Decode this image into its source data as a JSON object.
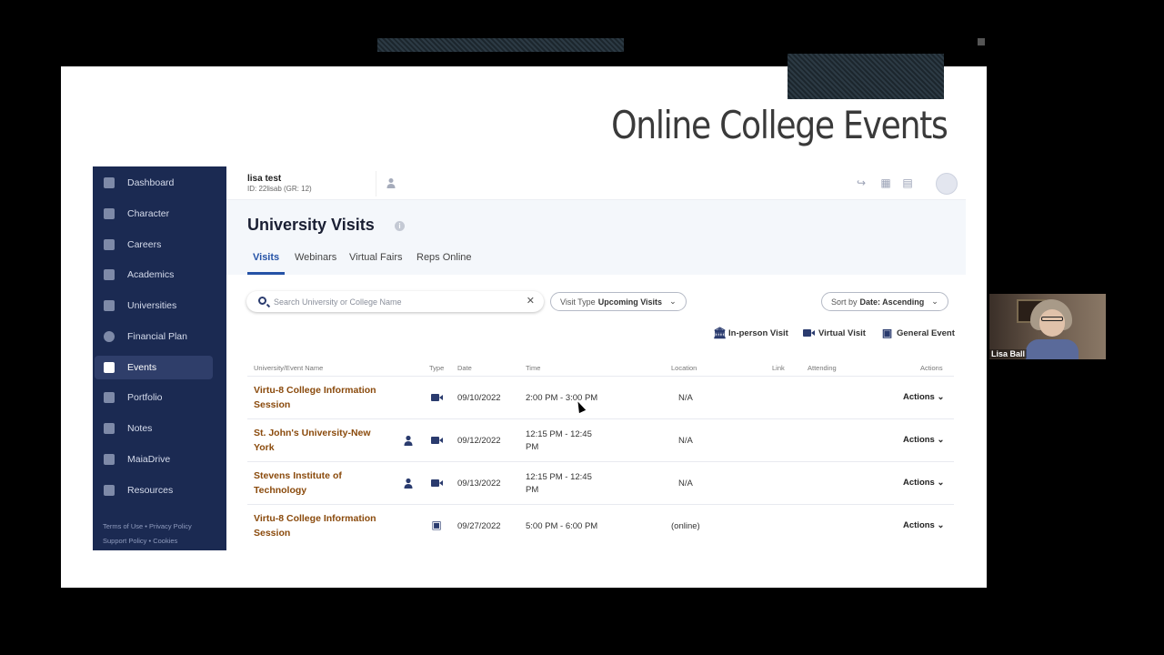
{
  "slide": {
    "title": "Online College Events"
  },
  "header": {
    "user_name": "lisa test",
    "user_id": "ID: 22lisab (GR: 12)"
  },
  "sidebar": {
    "items": [
      {
        "label": "Dashboard",
        "icon": "dashboard-icon"
      },
      {
        "label": "Character",
        "icon": "bar-chart-icon"
      },
      {
        "label": "Careers",
        "icon": "briefcase-icon"
      },
      {
        "label": "Academics",
        "icon": "academics-icon"
      },
      {
        "label": "Universities",
        "icon": "university-icon"
      },
      {
        "label": "Financial Plan",
        "icon": "dollar-icon"
      },
      {
        "label": "Events",
        "icon": "calendar-check-icon",
        "active": true
      },
      {
        "label": "Portfolio",
        "icon": "grid-icon"
      },
      {
        "label": "Notes",
        "icon": "notes-icon"
      },
      {
        "label": "MaiaDrive",
        "icon": "drive-icon"
      },
      {
        "label": "Resources",
        "icon": "list-icon"
      }
    ],
    "footer": {
      "terms": "Terms of Use",
      "privacy": "Privacy Policy",
      "support": "Support Policy",
      "cookies": "Cookies",
      "separator": "•"
    }
  },
  "page": {
    "title": "University Visits",
    "tabs": [
      "Visits",
      "Webinars",
      "Virtual Fairs",
      "Reps Online"
    ],
    "active_tab": "Visits"
  },
  "search": {
    "placeholder": "Search University or College Name"
  },
  "filters": {
    "visit_type_label": "Visit Type",
    "visit_type_value": "Upcoming Visits",
    "sort_label": "Sort by",
    "sort_value": "Date: Ascending"
  },
  "legend": {
    "in_person": "In-person Visit",
    "virtual": "Virtual Visit",
    "general": "General Event"
  },
  "table": {
    "headers": {
      "name": "University/Event Name",
      "type": "Type",
      "date": "Date",
      "time": "Time",
      "location": "Location",
      "link": "Link",
      "attending": "Attending",
      "actions": "Actions"
    },
    "rows": [
      {
        "name_line1": "Virtu-8 College Information",
        "name_line2": "Session",
        "date": "09/10/2022",
        "time_line1": "2:00 PM - 3:00 PM",
        "time_line2": "",
        "location": "N/A",
        "actions": "Actions"
      },
      {
        "name_line1": "St. John's University-New",
        "name_line2": "York",
        "date": "09/12/2022",
        "time_line1": "12:15 PM - 12:45",
        "time_line2": "PM",
        "location": "N/A",
        "actions": "Actions"
      },
      {
        "name_line1": "Stevens Institute of",
        "name_line2": "Technology",
        "date": "09/13/2022",
        "time_line1": "12:15 PM - 12:45",
        "time_line2": "PM",
        "location": "N/A",
        "actions": "Actions"
      },
      {
        "name_line1": "Virtu-8 College Information",
        "name_line2": "Session",
        "date": "09/27/2022",
        "time_line1": "5:00 PM - 6:00 PM",
        "time_line2": "",
        "location": "(online)",
        "actions": "Actions"
      }
    ]
  },
  "webcam": {
    "participant": "Lisa Ball"
  }
}
